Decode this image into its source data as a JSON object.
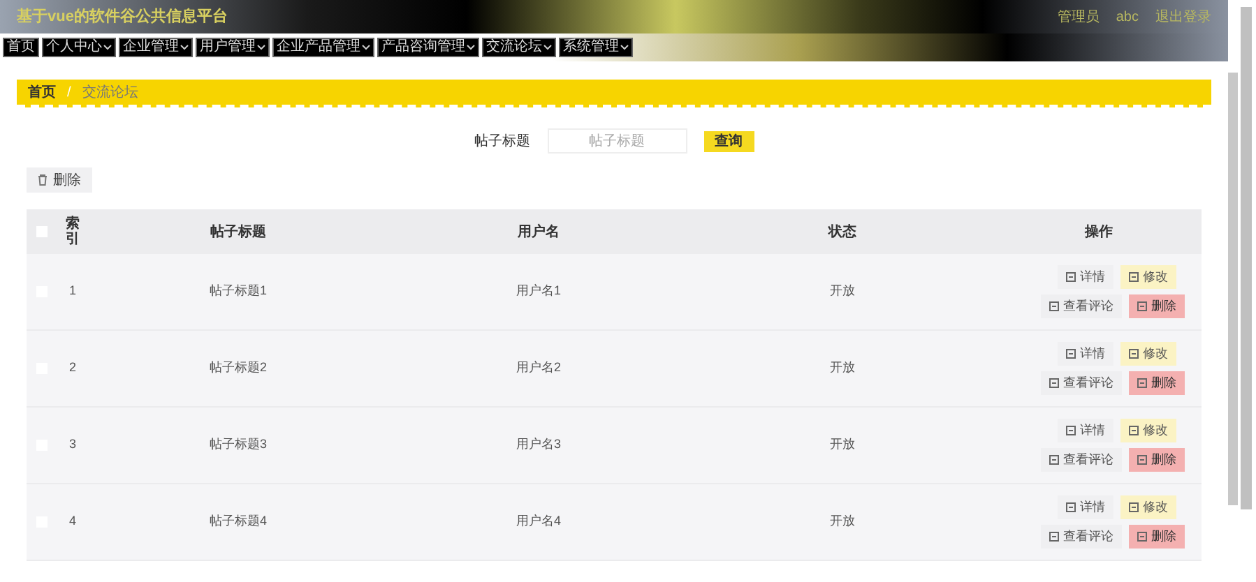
{
  "header": {
    "title": "基于vue的软件谷公共信息平台",
    "user_role": "管理员",
    "user_name": "abc",
    "logout": "退出登录"
  },
  "nav": [
    {
      "label": "首页",
      "dropdown": false
    },
    {
      "label": "个人中心",
      "dropdown": true
    },
    {
      "label": "企业管理",
      "dropdown": true
    },
    {
      "label": "用户管理",
      "dropdown": true
    },
    {
      "label": "企业产品管理",
      "dropdown": true
    },
    {
      "label": "产品咨询管理",
      "dropdown": true
    },
    {
      "label": "交流论坛",
      "dropdown": true
    },
    {
      "label": "系统管理",
      "dropdown": true
    }
  ],
  "breadcrumb": {
    "items": [
      "首页",
      "交流论坛"
    ],
    "separator": "/"
  },
  "search": {
    "label": "帖子标题",
    "placeholder": "帖子标题",
    "button": "查询"
  },
  "delete_button": "删除",
  "table": {
    "select_all_checked": false,
    "columns": [
      "索引",
      "帖子标题",
      "用户名",
      "状态",
      "操作"
    ],
    "rows": [
      {
        "checked": false,
        "index": "1",
        "title": "帖子标题1",
        "user": "用户名1",
        "status": "开放",
        "actions": [
          "详情",
          "修改",
          "查看评论",
          "删除"
        ]
      },
      {
        "checked": false,
        "index": "2",
        "title": "帖子标题2",
        "user": "用户名2",
        "status": "开放",
        "actions": [
          "详情",
          "修改",
          "查看评论",
          "删除"
        ]
      },
      {
        "checked": false,
        "index": "3",
        "title": "帖子标题3",
        "user": "用户名3",
        "status": "开放",
        "actions": [
          "详情",
          "修改",
          "查看评论",
          "删除"
        ]
      },
      {
        "checked": false,
        "index": "4",
        "title": "帖子标题4",
        "user": "用户名4",
        "status": "开放",
        "actions": [
          "详情",
          "修改",
          "查看评论",
          "删除"
        ]
      }
    ]
  }
}
